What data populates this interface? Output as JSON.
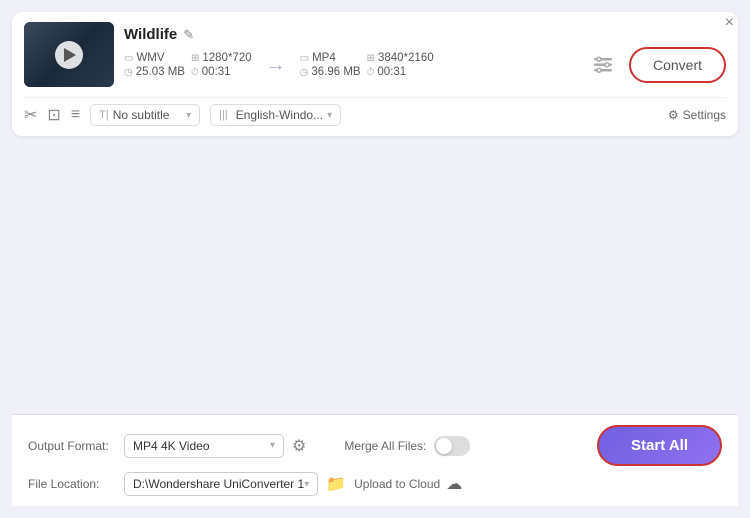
{
  "window": {
    "close_label": "×"
  },
  "file_card": {
    "title": "Wildlife",
    "source": {
      "format": "WMV",
      "resolution": "1280*720",
      "size": "25.03 MB",
      "duration": "00:31"
    },
    "target": {
      "format": "MP4",
      "resolution": "3840*2160",
      "size": "36.96 MB",
      "duration": "00:31"
    },
    "convert_button": "Convert",
    "subtitle_label": "No subtitle",
    "audio_label": "English-Windo...",
    "settings_label": "Settings"
  },
  "bottom_bar": {
    "output_format_label": "Output Format:",
    "output_format_value": "MP4 4K Video",
    "file_location_label": "File Location:",
    "file_location_value": "D:\\Wondershare UniConverter 1",
    "merge_label": "Merge All Files:",
    "upload_label": "Upload to Cloud",
    "start_all_button": "Start All"
  }
}
